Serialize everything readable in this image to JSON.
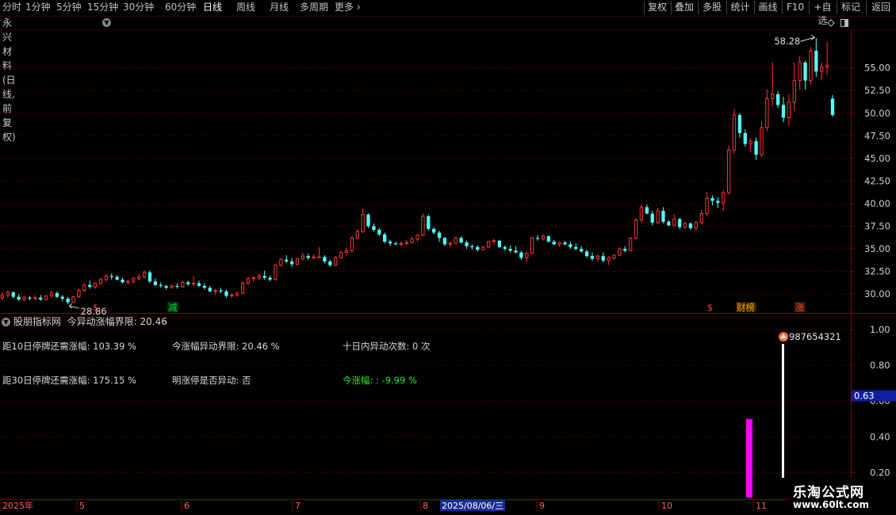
{
  "toolbar": {
    "periods": [
      "分时",
      "1分钟",
      "5分钟",
      "15分钟",
      "30分钟",
      "60分钟",
      "日线",
      "周线",
      "月线",
      "多周期",
      "更多"
    ],
    "active_period": "日线",
    "right_buttons": [
      "复权",
      "叠加",
      "多股",
      "统计",
      "画线",
      "F10",
      "+自选",
      "标记",
      "返回"
    ]
  },
  "title": "永兴材料(日线,前复权)",
  "main_chart": {
    "y_ticks": [
      "55.00",
      "52.50",
      "50.00",
      "47.50",
      "45.00",
      "42.50",
      "40.00",
      "37.50",
      "35.00",
      "32.50",
      "30.00"
    ],
    "high_label": "58.28",
    "low_label": "28.86",
    "markers": [
      "$",
      "减",
      "$",
      "财榜",
      "涨"
    ]
  },
  "indicator": {
    "title": "股朋指标网",
    "header_value": "今异动涨幅界限: 20.46",
    "lines": [
      "距10日停牌还需涨幅: 103.39 %",
      "今涨幅异动界限: 20.46 %",
      "十日内异动次数: 0 次",
      "距30日停牌还需涨幅: 175.15 %",
      "明涨停是否异动: 否",
      "今涨幅: : -9.99 %"
    ],
    "y_ticks": [
      "1.00",
      "0.80",
      "0.60",
      "0.40",
      "0.20"
    ],
    "current_value": "0.63",
    "bar_label": "987654321",
    "bar_values": [
      0.5,
      0.92
    ]
  },
  "x_axis": {
    "labels": [
      "2025年",
      "5",
      "6",
      "7",
      "8",
      "2025/08/06/三",
      "9",
      "10",
      "11"
    ]
  },
  "watermark": {
    "title": "乐淘公式网",
    "url": "www.60lt.com"
  },
  "colors": {
    "up": "#ff3232",
    "down": "#54ffff",
    "grid": "#7a0000",
    "magenta": "#ff00ff",
    "white_bar": "#ffffff"
  },
  "chart_data": {
    "type": "candlestick",
    "ylim": [
      28.0,
      59.0
    ],
    "ohlc": [
      [
        29.6,
        30.2,
        29.3,
        29.9
      ],
      [
        29.9,
        30.4,
        29.6,
        30.2
      ],
      [
        30.2,
        30.3,
        29.5,
        29.7
      ],
      [
        29.7,
        30.0,
        29.2,
        29.4
      ],
      [
        29.4,
        29.8,
        29.2,
        29.6
      ],
      [
        29.6,
        29.8,
        29.3,
        29.5
      ],
      [
        29.5,
        29.9,
        29.3,
        29.6
      ],
      [
        29.6,
        29.9,
        29.2,
        29.4
      ],
      [
        29.4,
        29.9,
        29.3,
        29.8
      ],
      [
        29.8,
        30.4,
        29.6,
        30.1
      ],
      [
        30.1,
        30.3,
        29.6,
        29.7
      ],
      [
        29.7,
        29.9,
        29.2,
        29.5
      ],
      [
        29.5,
        29.7,
        28.86,
        29.1
      ],
      [
        29.1,
        29.8,
        29.0,
        29.7
      ],
      [
        29.7,
        30.6,
        29.6,
        30.4
      ],
      [
        30.4,
        31.2,
        30.2,
        31.0
      ],
      [
        31.0,
        31.5,
        30.6,
        30.8
      ],
      [
        30.8,
        31.3,
        30.6,
        31.2
      ],
      [
        31.2,
        31.8,
        31.0,
        31.6
      ],
      [
        31.6,
        32.2,
        31.4,
        32.0
      ],
      [
        32.0,
        32.3,
        31.6,
        31.9
      ],
      [
        31.9,
        32.1,
        31.5,
        31.6
      ],
      [
        31.6,
        31.8,
        31.2,
        31.3
      ],
      [
        31.3,
        31.6,
        31.0,
        31.4
      ],
      [
        31.4,
        31.9,
        31.2,
        31.7
      ],
      [
        31.7,
        32.2,
        31.5,
        31.9
      ],
      [
        31.9,
        32.6,
        31.7,
        32.4
      ],
      [
        32.4,
        32.6,
        31.2,
        31.4
      ],
      [
        31.4,
        31.7,
        30.9,
        31.0
      ],
      [
        31.0,
        31.3,
        30.7,
        30.9
      ],
      [
        30.9,
        31.0,
        30.5,
        30.7
      ],
      [
        30.7,
        31.1,
        30.6,
        30.9
      ],
      [
        30.9,
        31.2,
        30.6,
        30.8
      ],
      [
        30.8,
        31.5,
        30.7,
        31.3
      ],
      [
        31.3,
        31.5,
        30.9,
        31.1
      ],
      [
        31.1,
        32.0,
        30.9,
        31.2
      ],
      [
        31.2,
        31.5,
        30.8,
        30.9
      ],
      [
        30.9,
        31.2,
        30.5,
        30.7
      ],
      [
        30.7,
        30.9,
        30.2,
        30.3
      ],
      [
        30.3,
        30.6,
        29.9,
        30.4
      ],
      [
        30.4,
        30.7,
        30.1,
        30.3
      ],
      [
        30.3,
        30.5,
        29.6,
        29.8
      ],
      [
        29.8,
        30.1,
        29.6,
        29.9
      ],
      [
        29.9,
        30.3,
        29.7,
        30.1
      ],
      [
        30.1,
        31.4,
        30.0,
        31.2
      ],
      [
        31.2,
        31.9,
        31.0,
        31.7
      ],
      [
        31.7,
        32.0,
        31.4,
        31.8
      ],
      [
        31.8,
        32.3,
        31.6,
        32.0
      ],
      [
        32.0,
        32.6,
        31.6,
        31.8
      ],
      [
        31.8,
        32.0,
        31.4,
        31.6
      ],
      [
        31.6,
        33.3,
        31.5,
        33.2
      ],
      [
        33.2,
        34.0,
        33.0,
        33.8
      ],
      [
        33.8,
        34.3,
        33.4,
        33.6
      ],
      [
        33.6,
        34.0,
        33.0,
        33.3
      ],
      [
        33.3,
        34.0,
        33.2,
        33.9
      ],
      [
        33.9,
        34.6,
        33.7,
        34.2
      ],
      [
        34.2,
        34.5,
        33.8,
        34.0
      ],
      [
        34.0,
        34.4,
        33.8,
        34.1
      ],
      [
        34.1,
        35.2,
        34.0,
        34.1
      ],
      [
        34.1,
        34.3,
        33.4,
        33.6
      ],
      [
        33.6,
        33.8,
        33.0,
        33.2
      ],
      [
        33.2,
        34.2,
        33.1,
        34.0
      ],
      [
        34.0,
        34.8,
        33.9,
        34.6
      ],
      [
        34.6,
        35.1,
        34.2,
        34.8
      ],
      [
        34.8,
        36.4,
        34.6,
        36.2
      ],
      [
        36.2,
        37.2,
        36.0,
        36.9
      ],
      [
        36.9,
        39.5,
        36.7,
        38.8
      ],
      [
        38.8,
        38.9,
        37.3,
        37.5
      ],
      [
        37.5,
        37.8,
        36.9,
        37.1
      ],
      [
        37.1,
        37.3,
        36.4,
        36.6
      ],
      [
        36.6,
        36.8,
        35.6,
        35.8
      ],
      [
        35.8,
        36.0,
        35.3,
        35.6
      ],
      [
        35.6,
        35.8,
        35.4,
        35.5
      ],
      [
        35.5,
        35.8,
        35.3,
        35.6
      ],
      [
        35.6,
        36.0,
        35.4,
        35.7
      ],
      [
        35.7,
        36.3,
        35.6,
        36.1
      ],
      [
        36.1,
        36.6,
        35.8,
        36.5
      ],
      [
        36.5,
        38.9,
        36.4,
        38.6
      ],
      [
        38.6,
        38.8,
        37.0,
        37.2
      ],
      [
        37.2,
        37.4,
        36.6,
        36.8
      ],
      [
        36.8,
        37.0,
        35.8,
        36.2
      ],
      [
        36.2,
        36.3,
        35.3,
        35.5
      ],
      [
        35.5,
        35.8,
        35.2,
        35.6
      ],
      [
        35.6,
        36.3,
        35.5,
        36.2
      ],
      [
        36.2,
        36.4,
        35.6,
        35.7
      ],
      [
        35.7,
        35.9,
        35.0,
        35.3
      ],
      [
        35.3,
        35.5,
        34.9,
        35.2
      ],
      [
        35.2,
        35.4,
        34.7,
        34.9
      ],
      [
        34.9,
        35.3,
        34.8,
        35.2
      ],
      [
        35.2,
        35.9,
        35.1,
        35.8
      ],
      [
        35.8,
        36.1,
        35.5,
        35.9
      ],
      [
        35.9,
        36.0,
        35.1,
        35.2
      ],
      [
        35.2,
        35.4,
        34.8,
        35.0
      ],
      [
        35.0,
        35.4,
        34.6,
        34.8
      ],
      [
        34.8,
        35.3,
        34.5,
        34.6
      ],
      [
        34.6,
        34.8,
        33.8,
        34.0
      ],
      [
        34.0,
        34.6,
        33.5,
        34.5
      ],
      [
        34.5,
        36.3,
        34.4,
        36.2
      ],
      [
        36.2,
        36.5,
        35.9,
        36.1
      ],
      [
        36.1,
        36.6,
        35.9,
        36.4
      ],
      [
        36.4,
        36.5,
        35.7,
        35.8
      ],
      [
        35.8,
        36.0,
        35.4,
        35.5
      ],
      [
        35.5,
        35.8,
        35.2,
        35.7
      ],
      [
        35.7,
        35.9,
        35.4,
        35.5
      ],
      [
        35.5,
        35.8,
        35.0,
        35.2
      ],
      [
        35.2,
        35.6,
        34.8,
        35.0
      ],
      [
        35.0,
        35.3,
        34.6,
        34.7
      ],
      [
        34.7,
        34.9,
        34.0,
        34.2
      ],
      [
        34.2,
        34.6,
        33.7,
        33.9
      ],
      [
        33.9,
        34.4,
        33.6,
        34.2
      ],
      [
        34.2,
        34.6,
        33.5,
        33.7
      ],
      [
        33.7,
        34.2,
        33.2,
        34.0
      ],
      [
        34.0,
        34.4,
        33.8,
        34.3
      ],
      [
        34.3,
        35.2,
        34.2,
        35.0
      ],
      [
        35.0,
        35.3,
        34.6,
        34.8
      ],
      [
        34.8,
        36.3,
        34.7,
        36.2
      ],
      [
        36.2,
        38.4,
        36.0,
        38.2
      ],
      [
        38.2,
        39.9,
        37.9,
        39.6
      ],
      [
        39.6,
        39.9,
        38.8,
        38.9
      ],
      [
        38.9,
        39.2,
        37.6,
        37.9
      ],
      [
        37.9,
        39.5,
        37.7,
        39.2
      ],
      [
        39.2,
        39.6,
        37.8,
        38.0
      ],
      [
        38.0,
        38.2,
        37.5,
        37.6
      ],
      [
        37.6,
        38.8,
        37.5,
        38.3
      ],
      [
        38.3,
        38.4,
        37.2,
        37.4
      ],
      [
        37.4,
        38.0,
        37.2,
        37.8
      ],
      [
        37.8,
        37.9,
        37.1,
        37.3
      ],
      [
        37.3,
        38.1,
        37.0,
        37.9
      ],
      [
        37.9,
        39.3,
        37.7,
        38.9
      ],
      [
        38.9,
        41.3,
        38.6,
        40.6
      ],
      [
        40.6,
        40.9,
        39.8,
        40.3
      ],
      [
        40.3,
        40.7,
        39.5,
        40.1
      ],
      [
        40.1,
        41.5,
        39.2,
        41.2
      ],
      [
        41.2,
        46.4,
        41.0,
        45.9
      ],
      [
        45.9,
        50.5,
        45.5,
        49.8
      ],
      [
        49.8,
        50.0,
        47.3,
        47.8
      ],
      [
        47.8,
        48.2,
        46.3,
        46.6
      ],
      [
        46.6,
        47.2,
        45.7,
        46.9
      ],
      [
        46.9,
        47.3,
        44.8,
        45.4
      ],
      [
        45.4,
        49.1,
        45.2,
        48.4
      ],
      [
        48.4,
        52.6,
        48.0,
        51.6
      ],
      [
        51.6,
        55.6,
        50.8,
        52.1
      ],
      [
        52.1,
        52.4,
        50.6,
        50.9
      ],
      [
        50.9,
        51.8,
        49.0,
        49.5
      ],
      [
        49.5,
        52.1,
        48.6,
        51.2
      ],
      [
        51.2,
        55.6,
        50.2,
        53.6
      ],
      [
        53.6,
        56.3,
        52.6,
        55.6
      ],
      [
        55.6,
        55.8,
        52.6,
        53.6
      ],
      [
        53.6,
        57.3,
        53.1,
        56.9
      ],
      [
        56.9,
        58.28,
        54.0,
        54.6
      ],
      [
        54.6,
        55.6,
        53.6,
        55.1
      ],
      [
        55.1,
        57.9,
        54.2,
        55.3
      ],
      [
        51.6,
        52.0,
        49.6,
        49.8
      ]
    ]
  }
}
